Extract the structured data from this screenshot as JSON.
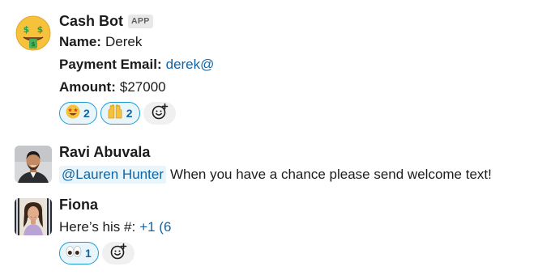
{
  "messages": [
    {
      "sender": "Cash Bot",
      "badge": "APP",
      "avatar_icon": "money-mouth-face-icon",
      "lines": {
        "name_label": "Name:",
        "name_value": "Derek",
        "email_label": "Payment Email:",
        "email_value": "derek@",
        "amount_label": "Amount:",
        "amount_value": "$27000"
      },
      "reactions": [
        {
          "icon": "star-struck-emoji-icon",
          "count": "2",
          "selected": true
        },
        {
          "icon": "raising-hands-emoji-icon",
          "count": "2",
          "selected": true
        }
      ]
    },
    {
      "sender": "Ravi Abuvala",
      "avatar_icon": "user-photo-ravi",
      "mention": "@Lauren Hunter",
      "text": "When you have a chance please send welcome text!"
    },
    {
      "sender": "Fiona",
      "avatar_icon": "user-photo-fiona",
      "text_prefix": "Here’s his #:",
      "phone_value": "+1 (6",
      "reactions": [
        {
          "icon": "eyes-emoji-icon",
          "count": "1",
          "selected": true
        }
      ]
    }
  ],
  "colors": {
    "link": "#1264a3",
    "reaction_border": "#1d9bd1",
    "reaction_bg": "#e8f5fa"
  }
}
